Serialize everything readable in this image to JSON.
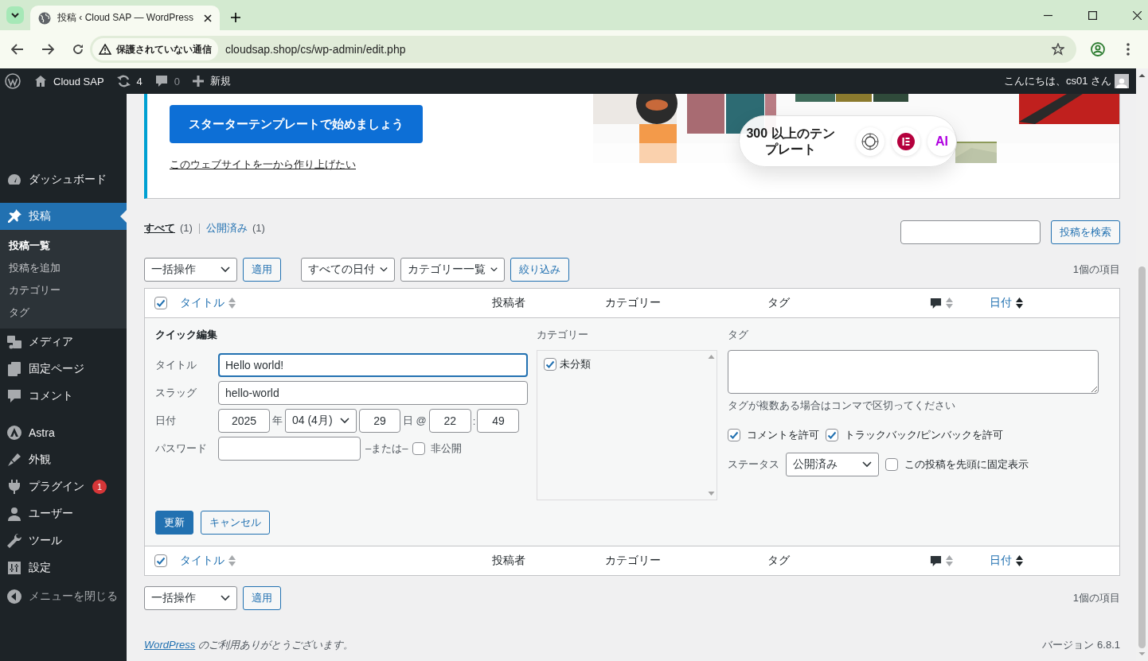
{
  "browser": {
    "tab_title": "投稿 ‹ Cloud SAP — WordPress",
    "security_label": "保護されていない通信",
    "url": "cloudsap.shop/cs/wp-admin/edit.php"
  },
  "admin_bar": {
    "site_name": "Cloud SAP",
    "updates": "4",
    "comments": "0",
    "new_label": "新規",
    "greeting": "こんにちは、cs01 さん"
  },
  "sidebar": {
    "groups": [
      [
        {
          "label": "ダッシュボード",
          "selected": false
        }
      ],
      [
        {
          "label": "投稿",
          "selected": true,
          "children": [
            {
              "label": "投稿一覧",
              "selected": true
            },
            {
              "label": "投稿を追加",
              "selected": false
            },
            {
              "label": "カテゴリー",
              "selected": false
            },
            {
              "label": "タグ",
              "selected": false
            }
          ]
        },
        {
          "label": "メディア",
          "selected": false
        },
        {
          "label": "固定ページ",
          "selected": false
        },
        {
          "label": "コメント",
          "selected": false
        }
      ],
      [
        {
          "label": "Astra",
          "selected": false
        },
        {
          "label": "外観",
          "selected": false
        },
        {
          "label": "プラグイン",
          "selected": false,
          "badge": "1"
        },
        {
          "label": "ユーザー",
          "selected": false
        },
        {
          "label": "ツール",
          "selected": false
        },
        {
          "label": "設定",
          "selected": false
        }
      ]
    ],
    "collapse": "メニューを閉じる"
  },
  "banner": {
    "button": "スターターテンプレートで始めましょう",
    "link": "このウェブサイトを一から作り上げたい",
    "templates_text": "300 以上のテンプレート",
    "ai_label": "AI"
  },
  "views": [
    {
      "label": "すべて",
      "count": "(1)",
      "selected": true
    },
    {
      "label": "公開済み",
      "count": "(1)",
      "selected": false
    }
  ],
  "search": {
    "button": "投稿を検索"
  },
  "top_toolbar": {
    "bulk_action": "一括操作",
    "apply": "適用",
    "date_filter": "すべての日付",
    "category_filter": "カテゴリー一覧",
    "filter_button": "絞り込み",
    "item_count": "1個の項目"
  },
  "table": {
    "select_all_checked": true,
    "columns": [
      {
        "kind": "sortable",
        "label": "タイトル",
        "sorted": false
      },
      {
        "kind": "plain",
        "label": "投稿者"
      },
      {
        "kind": "plain",
        "label": "カテゴリー"
      },
      {
        "kind": "plain",
        "label": "タグ"
      },
      {
        "kind": "comments",
        "sorted": false
      },
      {
        "kind": "sortable",
        "label": "日付",
        "sorted": true
      }
    ],
    "quick_edit": {
      "heading": "クイック編集",
      "title": {
        "label": "タイトル",
        "value": "Hello world!",
        "focused": true
      },
      "slug": {
        "label": "スラッグ",
        "value": "hello-world"
      },
      "date": {
        "label": "日付",
        "year": "2025",
        "year_unit": "年",
        "month": "04 (4月)",
        "day": "29",
        "day_unit": "日 @",
        "hour": "22",
        "separator": ":",
        "minute": "49"
      },
      "password": {
        "label": "パスワード",
        "or": "–または–",
        "private_label": "非公開",
        "private_checked": false
      },
      "categories": {
        "label": "カテゴリー",
        "items": [
          {
            "label": "未分類",
            "checked": true
          }
        ]
      },
      "tags": {
        "label": "タグ",
        "hint": "タグが複数ある場合はコンマで区切ってください"
      },
      "allow_comments": {
        "label": "コメントを許可",
        "checked": true
      },
      "allow_pings": {
        "label": "トラックバック/ピンバックを許可",
        "checked": true
      },
      "status": {
        "label": "ステータス",
        "value": "公開済み"
      },
      "sticky": {
        "label": "この投稿を先頭に固定表示",
        "checked": false
      },
      "update_button": "更新",
      "cancel_button": "キャンセル"
    },
    "footer_select_all_checked": true,
    "footer_columns": [
      {
        "kind": "sortable",
        "label": "タイトル",
        "sorted": false
      },
      {
        "kind": "plain",
        "label": "投稿者"
      },
      {
        "kind": "plain",
        "label": "カテゴリー"
      },
      {
        "kind": "plain",
        "label": "タグ"
      },
      {
        "kind": "comments",
        "sorted": false
      },
      {
        "kind": "sortable",
        "label": "日付",
        "sorted": true
      }
    ]
  },
  "bottom_toolbar": {
    "bulk_action": "一括操作",
    "apply": "適用",
    "item_count": "1個の項目"
  },
  "footer": {
    "link": "WordPress",
    "thanks": "のご利用ありがとうございます。",
    "version": "バージョン 6.8.1"
  }
}
